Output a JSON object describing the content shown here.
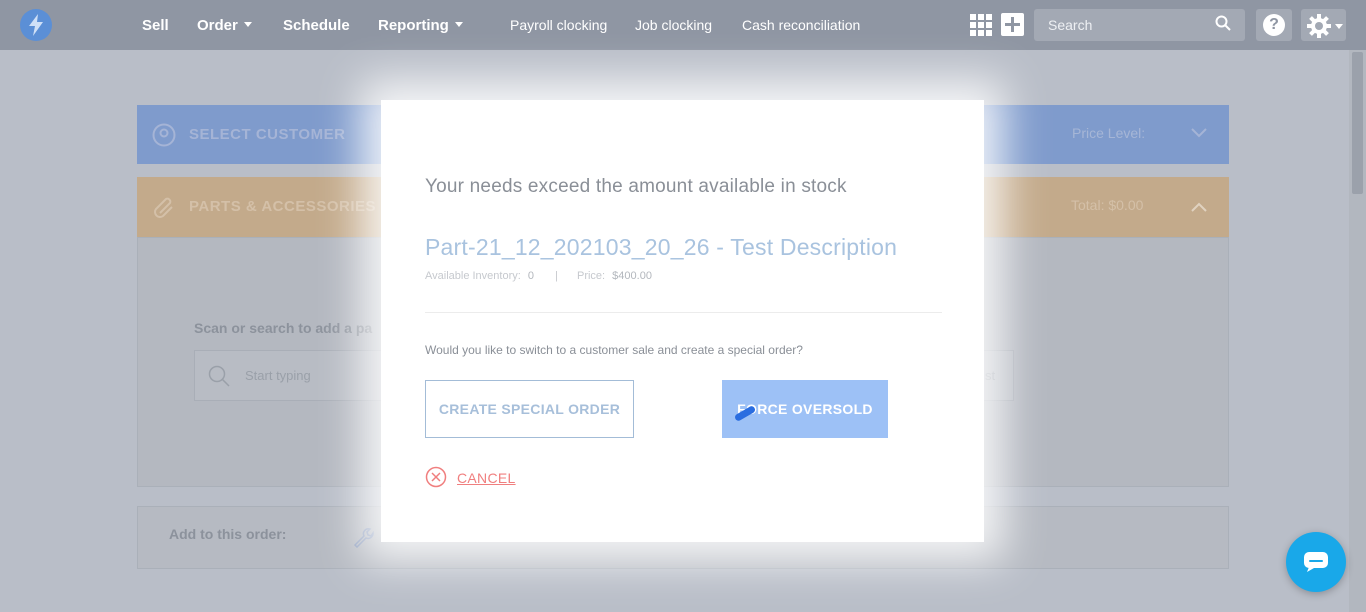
{
  "nav": {
    "sell": "Sell",
    "order": "Order",
    "schedule": "Schedule",
    "reporting": "Reporting",
    "payroll_clocking": "Payroll clocking",
    "job_clocking": "Job clocking",
    "cash_reconciliation": "Cash reconciliation",
    "search_placeholder": "Search",
    "help_label": "?"
  },
  "background": {
    "select_customer": "SELECT CUSTOMER",
    "price_level": "Price Level:",
    "parts_accessories": "PARTS & ACCESSORIES",
    "total": "Total: $0.00",
    "scan_label": "Scan or search to add a pa",
    "scan_placeholder": "Start typing",
    "extra_text": "st",
    "add_to_order": "Add to this order:"
  },
  "modal": {
    "heading": "Your needs exceed the amount available in stock",
    "part_name": "Part-21_12_202103_20_26 - Test Description",
    "available_inventory_label": "Available Inventory:",
    "available_inventory_value": "0",
    "separator": "|",
    "price_label": "Price:",
    "price_value": "$400.00",
    "question": "Would you like to switch to a customer sale and create a special order?",
    "create_special_order": "CREATE SPECIAL ORDER",
    "force_oversold": "FORCE OVERSOLD",
    "cancel": "CANCEL"
  },
  "colors": {
    "topbar": "#8f96a3",
    "accent_blue": "#9dc1f6",
    "cancel_red": "#f07f7f",
    "chat": "#19a8e9"
  },
  "icons": {
    "logo": "lightning-bolt-icon",
    "apps": "grid-icon",
    "add": "plus-icon",
    "search": "search-icon",
    "help": "help-icon",
    "settings": "gear-icon",
    "customer": "person-icon",
    "parts": "paperclip-icon",
    "cancel": "close-circle-icon",
    "chat": "chat-icon"
  }
}
